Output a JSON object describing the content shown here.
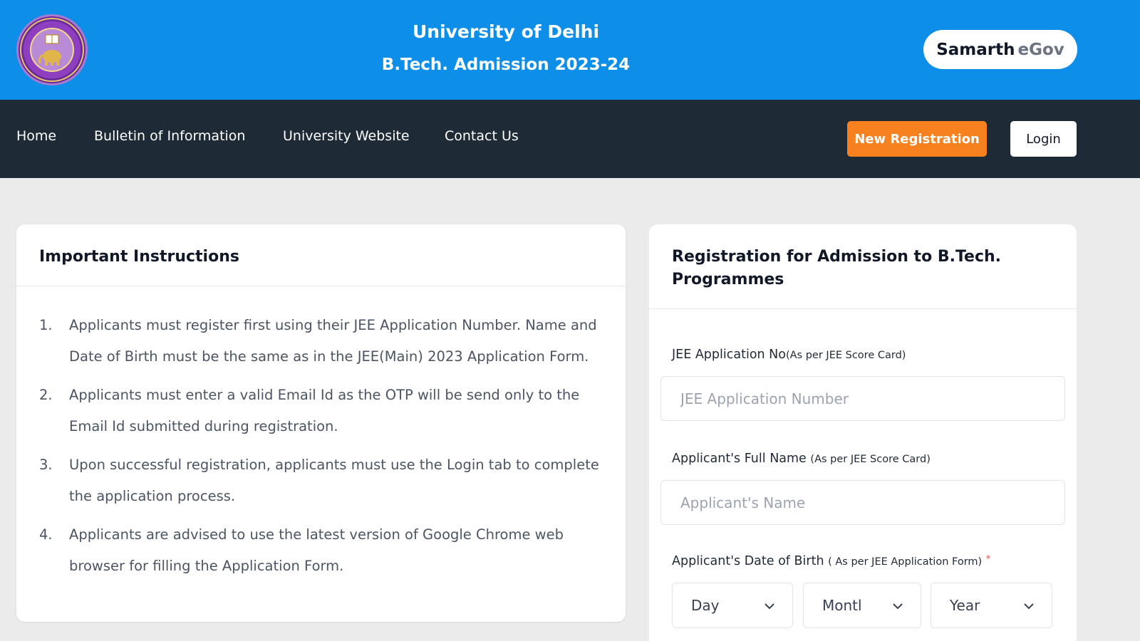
{
  "header": {
    "university": "University of Delhi",
    "admission": "B.Tech. Admission 2023-24",
    "brand_primary": "Samarth",
    "brand_secondary": "eGov",
    "bg_color": "#0d8ee9"
  },
  "nav": {
    "items": [
      {
        "label": "Home"
      },
      {
        "label": "Bulletin of Information"
      },
      {
        "label": "University Website"
      },
      {
        "label": "Contact Us"
      }
    ],
    "new_registration": "New Registration",
    "login": "Login",
    "bg_color": "#1f2a37",
    "accent_color": "#f7811f"
  },
  "instructions": {
    "title": "Important Instructions",
    "items": [
      {
        "num": "1.",
        "text": "Applicants must register first using their JEE Application Number. Name and Date of Birth must be the same as in the JEE(Main) 2023 Application Form."
      },
      {
        "num": "2.",
        "text": "Applicants must enter a valid Email Id as the OTP will be send only to the Email Id submitted during registration."
      },
      {
        "num": "3.",
        "text": "Upon successful registration, applicants must use the Login tab to complete the application process."
      },
      {
        "num": "4.",
        "text": "Applicants are advised to use the latest version of Google Chrome web browser for filling the Application Form."
      }
    ]
  },
  "registration": {
    "title": "Registration for Admission to B.Tech. Programmes",
    "jee_label": "JEE Application No",
    "jee_sub": "(As per JEE Score Card)",
    "jee_placeholder": "JEE Application Number",
    "jee_value": "",
    "name_label": "Applicant's Full Name",
    "name_sub": "(As per JEE Score Card)",
    "name_placeholder": "Applicant's Name",
    "name_value": "",
    "dob_label": "Applicant's Date of Birth",
    "dob_sub": "( As per JEE Application Form)",
    "dob_required": "*",
    "day": "Day",
    "month": "Montl",
    "year": "Year"
  }
}
